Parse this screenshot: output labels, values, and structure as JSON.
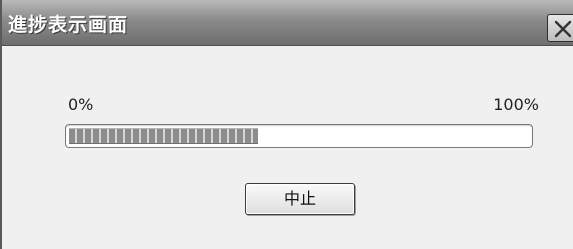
{
  "window": {
    "title": "進捗表示画面",
    "close_icon": "close-icon"
  },
  "progress": {
    "start_label": "0%",
    "end_label": "100%",
    "value_percent": 41
  },
  "actions": {
    "stop_label": "中止"
  },
  "colors": {
    "titlebar": "#8a8a8a",
    "title_text": "#ffffff",
    "progress_fill": "#8c8c8c",
    "window_bg": "#f0f0f0"
  }
}
